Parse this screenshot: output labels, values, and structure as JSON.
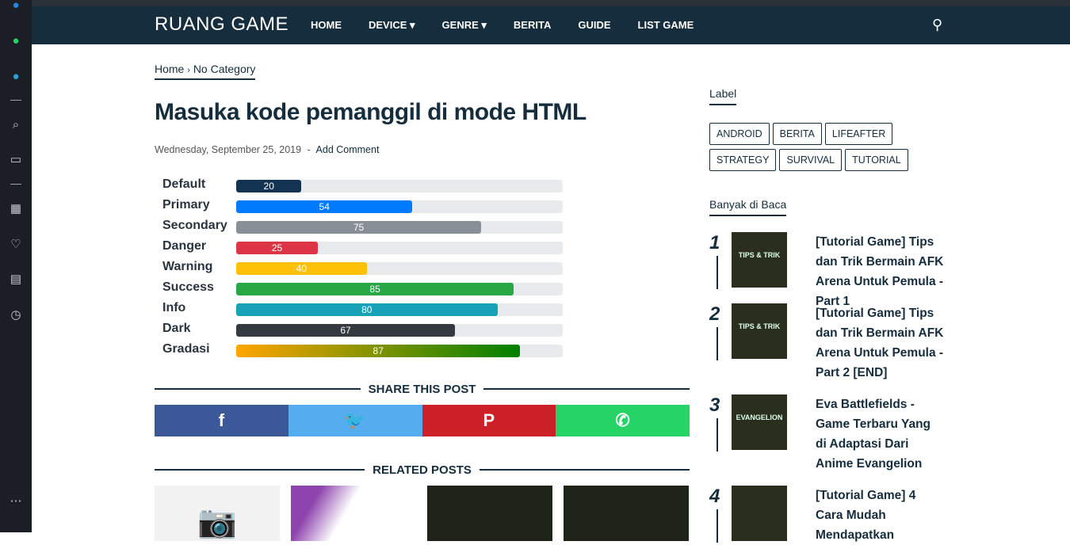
{
  "dock": {
    "icons": [
      "messenger-icon",
      "whatsapp-icon",
      "telegram-icon",
      "search-icon",
      "wallet-icon",
      "apps-icon",
      "heart-icon",
      "news-icon",
      "history-icon",
      "more-icon"
    ]
  },
  "nav": {
    "logo": "RUANG GAME",
    "items": [
      "HOME",
      "DEVICE ▾",
      "GENRE ▾",
      "BERITA",
      "GUIDE",
      "LIST GAME"
    ]
  },
  "breadcrumb": {
    "home": "Home",
    "sep": "›",
    "current": "No Category"
  },
  "post": {
    "title": "Masuka kode pemanggil di mode HTML",
    "date": "Wednesday, September 25, 2019",
    "sep": "-",
    "comment": "Add Comment"
  },
  "progress": [
    {
      "label": "Default",
      "value": 20,
      "color": "#143352"
    },
    {
      "label": "Primary",
      "value": 54,
      "color": "#007bff"
    },
    {
      "label": "Secondary",
      "value": 75,
      "color": "#898f96"
    },
    {
      "label": "Danger",
      "value": 25,
      "color": "#dc3545"
    },
    {
      "label": "Warning",
      "value": 40,
      "color": "#ffc107"
    },
    {
      "label": "Success",
      "value": 85,
      "color": "#28a745"
    },
    {
      "label": "Info",
      "value": 80,
      "color": "#17a2b8"
    },
    {
      "label": "Dark",
      "value": 67,
      "color": "#343a40"
    },
    {
      "label": "Gradasi",
      "value": 87,
      "color": "linear-gradient(90deg,#ffa500,#008000)"
    }
  ],
  "share": {
    "title": "SHARE THIS POST",
    "buttons": [
      {
        "icon": "f",
        "color": "#3b5998"
      },
      {
        "icon": "🐦",
        "color": "#55acee"
      },
      {
        "icon": "P",
        "color": "#cb2027"
      },
      {
        "icon": "✆",
        "color": "#25d366"
      }
    ]
  },
  "related": {
    "title": "RELATED POSTS"
  },
  "sidebar": {
    "label_title": "Label",
    "tags": [
      "ANDROID",
      "BERITA",
      "LIFEAFTER",
      "STRATEGY",
      "SURVIVAL",
      "TUTORIAL"
    ],
    "popular_title": "Banyak di Baca",
    "popular": [
      {
        "num": "1",
        "title": "[Tutorial Game] Tips dan Trik Bermain AFK Arena Untuk Pemula - Part 1",
        "thumb": "TIPS & TRIK"
      },
      {
        "num": "2",
        "title": "[Tutorial Game] Tips dan Trik Bermain AFK Arena Untuk Pemula - Part 2 [END]",
        "thumb": "TIPS & TRIK"
      },
      {
        "num": "3",
        "title": "Eva Battlefields - Game Terbaru Yang di Adaptasi Dari Anime Evangelion",
        "thumb": "EVANGELION"
      },
      {
        "num": "4",
        "title": "[Tutorial Game] 4 Cara Mudah Mendapatkan",
        "thumb": ""
      }
    ]
  }
}
